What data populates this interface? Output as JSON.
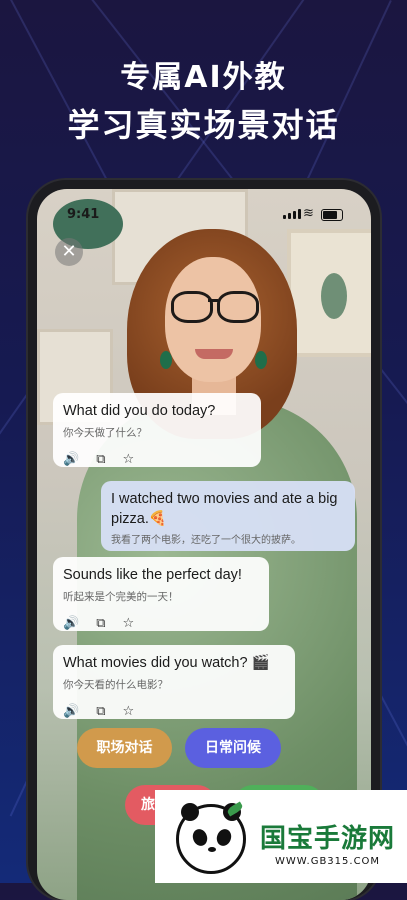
{
  "headline": {
    "line1": "专属AI外教",
    "line2": "学习真实场景对话"
  },
  "status_bar": {
    "time": "9:41"
  },
  "chat": [
    {
      "role": "ai",
      "en": "What did you do today?",
      "zh": "你今天做了什么？"
    },
    {
      "role": "me",
      "en": "I watched two movies and ate a big pizza.🍕",
      "zh": "我看了两个电影，还吃了一个很大的披萨。"
    },
    {
      "role": "ai",
      "en": "Sounds like the perfect day!",
      "zh": "听起来是个完美的一天！"
    },
    {
      "role": "ai",
      "en": "What movies did you watch? 🎬",
      "zh": "你今天看的什么电影？"
    }
  ],
  "tools": {
    "speaker": "🔊",
    "copy": "⧉",
    "star": "☆"
  },
  "topics": [
    {
      "label": "职场对话",
      "color": "#d19a4c"
    },
    {
      "label": "日常问候",
      "color": "#5b60e0"
    },
    {
      "label": "旅",
      "color": "#e35b62"
    }
  ],
  "watermark": {
    "brand": "国宝手游网",
    "url": "WWW.GB315.COM"
  }
}
